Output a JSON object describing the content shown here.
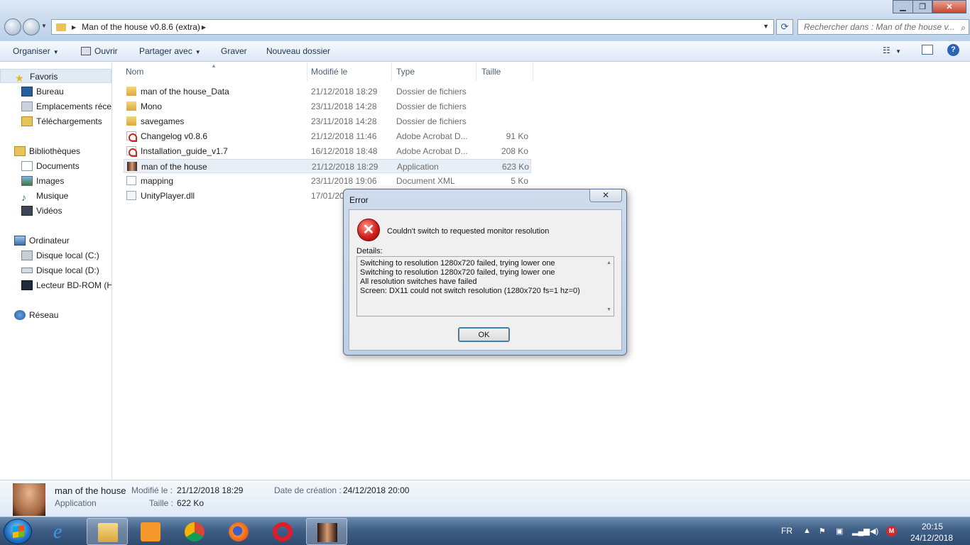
{
  "window": {
    "address_crumb": "Man of the house v0.8.6 (extra)",
    "search_placeholder": "Rechercher dans : Man of the house v...",
    "minimize_glyph": "▁",
    "maximize_glyph": "❐",
    "close_glyph": "✕"
  },
  "toolbar": {
    "organiser": "Organiser",
    "ouvrir": "Ouvrir",
    "partager": "Partager avec",
    "graver": "Graver",
    "nouveau_dossier": "Nouveau dossier",
    "help_glyph": "?"
  },
  "navpane": {
    "favoris": "Favoris",
    "bureau": "Bureau",
    "emplacements": "Emplacements récents",
    "telechargements": "Téléchargements",
    "bibliotheques": "Bibliothèques",
    "documents": "Documents",
    "images": "Images",
    "musique": "Musique",
    "videos": "Vidéos",
    "ordinateur": "Ordinateur",
    "disque_c": "Disque local (C:)",
    "disque_d": "Disque local (D:)",
    "lecteur_bd": "Lecteur BD-ROM (H:)",
    "reseau": "Réseau"
  },
  "columns": {
    "name": "Nom",
    "modified": "Modifié le",
    "type": "Type",
    "size": "Taille"
  },
  "files": [
    {
      "name": "man of the house_Data",
      "date": "21/12/2018 18:29",
      "type": "Dossier de fichiers",
      "size": "",
      "icon": "folder-icon"
    },
    {
      "name": "Mono",
      "date": "23/11/2018 14:28",
      "type": "Dossier de fichiers",
      "size": "",
      "icon": "folder-icon"
    },
    {
      "name": "savegames",
      "date": "23/11/2018 14:28",
      "type": "Dossier de fichiers",
      "size": "",
      "icon": "folder-icon"
    },
    {
      "name": "Changelog v0.8.6",
      "date": "21/12/2018 11:46",
      "type": "Adobe Acrobat D...",
      "size": "91 Ko",
      "icon": "pdf-icon"
    },
    {
      "name": "Installation_guide_v1.7",
      "date": "16/12/2018 18:48",
      "type": "Adobe Acrobat D...",
      "size": "208 Ko",
      "icon": "pdf-icon"
    },
    {
      "name": "man of the house",
      "date": "21/12/2018 18:29",
      "type": "Application",
      "size": "623 Ko",
      "icon": "app-icon"
    },
    {
      "name": "mapping",
      "date": "23/11/2018 19:06",
      "type": "Document XML",
      "size": "5 Ko",
      "icon": "xml-icon"
    },
    {
      "name": "UnityPlayer.dll",
      "date": "17/01/20",
      "type": "",
      "size": "",
      "icon": "dll-icon"
    }
  ],
  "details": {
    "name": "man of the house",
    "kind": "Application",
    "modified_label": "Modifié le :",
    "modified_value": "21/12/2018 18:29",
    "size_label": "Taille :",
    "size_value": "622 Ko",
    "created_label": "Date de création :",
    "created_value": "24/12/2018 20:00"
  },
  "dialog": {
    "title": "Error",
    "close_glyph": "✕",
    "message": "Couldn't switch to requested monitor resolution",
    "details_label": "Details:",
    "details_lines": [
      "Switching to resolution 1280x720 failed, trying lower one",
      "Switching to resolution 1280x720 failed, trying lower one",
      "All resolution switches have failed",
      "Screen: DX11 could not switch resolution (1280x720 fs=1 hz=0)"
    ],
    "ok_label": "OK"
  },
  "taskbar": {
    "language": "FR",
    "time": "20:15",
    "date": "24/12/2018"
  },
  "colors": {
    "accent": "#2b63b8",
    "error_red": "#d0201a",
    "taskbar": "#405f86",
    "selection": "#e8eef6"
  }
}
